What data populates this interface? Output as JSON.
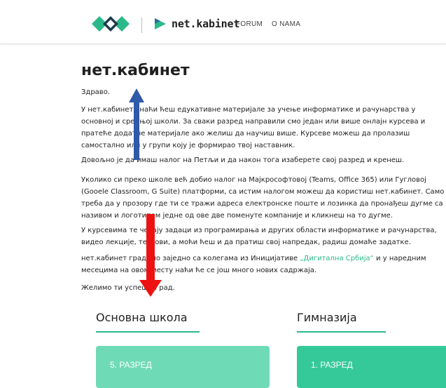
{
  "header": {
    "brand_name_prefix": "net",
    "brand_name_suffix": ".kabinet",
    "nav": {
      "forum": "FORUM",
      "about": "O NAMA"
    }
  },
  "main": {
    "title": "нет.кабинет",
    "greeting": "Здраво.",
    "paragraphs": [
      "У нет.кабинету наћи ћеш едукативне материјале за учење информатике и рачунарства у основној и средњој школи. За сваки разред направили смо један или више онлајн курсева и пратеће додатне материјале ако желиш да научиш више. Курсеве можеш да пролазиш самостално или у групи коју је формирао твој наставник.",
      "Довољно је да имаш налог на Петљи и да након тога изаберете свој разред и кренеш.",
      "Уколико си преко школе већ добио налог на Мајкрософтовој (Teams, Office 365) или Гугловој (Gooele Classroom, G Suite) платформи, са истим налогом можеш да користиш нет.кабинет. Само треба да у прозору где ти се тражи адреса електронске поште и лозинка да пронађеш дугме са називом и логотипом једне од ове две поменуте компаније и кликнеш на то дугме.",
      "У курсевима те чекају задаци из програмирања и других области информатике и рачунарства, видео лекције, тестови, а моћи ћеш и да пратиш свој напредак, радиш домаће задатке."
    ],
    "initiative_before": "нет.кабинет градимо заједно са колегама из Иницијативе ",
    "initiative_link": "„Дигитална Србија“",
    "initiative_after": " и у наредним месецима на овом месту наћи ће се још много нових садржаја.",
    "closing": "Желимо ти успешан рад."
  },
  "sections": {
    "primary": {
      "title": "Основна школа",
      "first_card": "5. РАЗРЕД"
    },
    "gymnasium": {
      "title": "Гимназија",
      "first_card": "1. РАЗРЕД"
    }
  },
  "colors": {
    "accent": "#2bb989",
    "card_primary": "#6fdab6",
    "card_gym": "#35c999",
    "arrow_blue": "#2e5aa8",
    "arrow_red": "#ee1111"
  },
  "icons": {
    "logo": "net-kabinet-logo-icon",
    "brand": "play-triangle-icon"
  }
}
